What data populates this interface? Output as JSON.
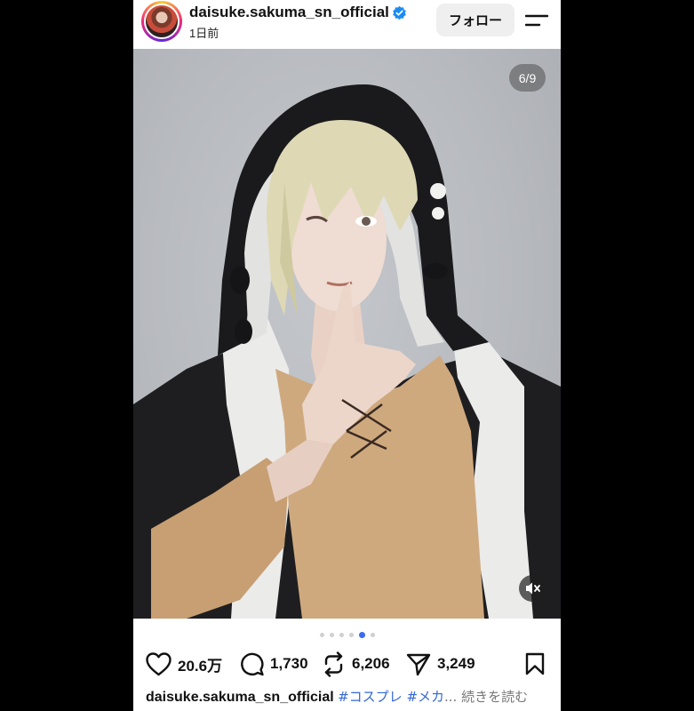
{
  "header": {
    "username": "daisuke.sakuma_sn_official",
    "time": "1日前",
    "follow_label": "フォロー"
  },
  "icons": {
    "avatar": "avatar",
    "verified": "verified-badge-icon",
    "menu": "menu-icon",
    "mute": "muted-speaker-icon",
    "like": "heart-icon",
    "comment": "comment-bubble-icon",
    "repost": "repost-icon",
    "share": "paper-plane-icon",
    "save": "bookmark-icon"
  },
  "photo": {
    "counter": "6/9"
  },
  "carousel": {
    "total_dots": 6,
    "active_index": 4
  },
  "actions": {
    "likes": "20.6万",
    "comments": "1,730",
    "reposts": "6,206",
    "shares": "3,249"
  },
  "caption": {
    "username": "daisuke.sakuma_sn_official",
    "tags": "#コスプレ #メカ",
    "ellipsis": "... ",
    "more": "続きを読む"
  },
  "colors": {
    "accent_blue": "#3a6bf0",
    "verified_blue": "#1d8cf0",
    "hashtag_blue": "#3568d4"
  }
}
